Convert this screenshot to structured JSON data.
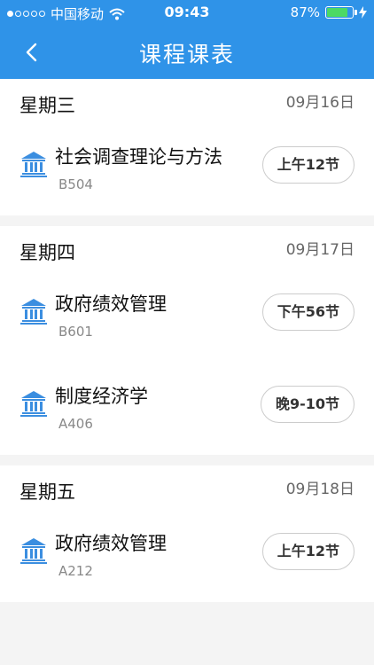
{
  "status": {
    "carrier": "中国移动",
    "time": "09:43",
    "battery": "87%",
    "battery_level": 0.87
  },
  "nav": {
    "title": "课程课表",
    "back_icon": "chevron-left-icon"
  },
  "colors": {
    "brand": "#2f93e8",
    "icon": "#3b8ee0"
  },
  "days": [
    {
      "name": "星期三",
      "date": "09月16日",
      "courses": [
        {
          "name": "社会调查理论与方法",
          "room": "B504",
          "time": "上午12节"
        }
      ]
    },
    {
      "name": "星期四",
      "date": "09月17日",
      "courses": [
        {
          "name": "政府绩效管理",
          "room": "B601",
          "time": "下午56节"
        },
        {
          "name": "制度经济学",
          "room": "A406",
          "time": "晚9-10节"
        }
      ]
    },
    {
      "name": "星期五",
      "date": "09月18日",
      "courses": [
        {
          "name": "政府绩效管理",
          "room": "A212",
          "time": "上午12节"
        }
      ]
    }
  ]
}
